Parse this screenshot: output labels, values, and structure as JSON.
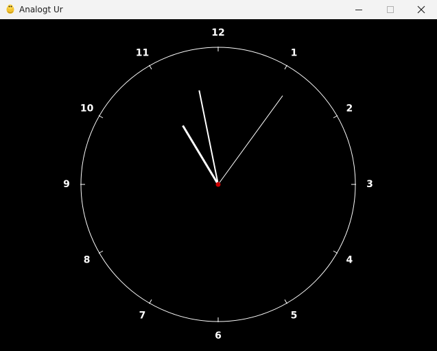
{
  "window": {
    "title": "Analogt Ur",
    "app_icon": "python-snake-icon",
    "controls": {
      "minimize_icon": "minimize-icon",
      "maximize_icon": "maximize-icon",
      "close_icon": "close-icon"
    }
  },
  "clock": {
    "background": "#000000",
    "face_color": "#ffffff",
    "center_dot_color": "#cc0000",
    "numerals": [
      "12",
      "1",
      "2",
      "3",
      "4",
      "5",
      "6",
      "7",
      "8",
      "9",
      "10",
      "11"
    ],
    "time": {
      "hour": 10,
      "minute": 58,
      "second": 6
    }
  }
}
